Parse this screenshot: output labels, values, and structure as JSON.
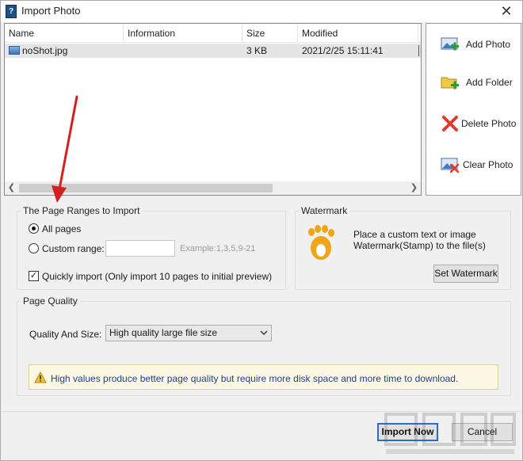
{
  "window": {
    "title": "Import Photo",
    "app_icon_glyph": "?"
  },
  "file_list": {
    "columns": [
      "Name",
      "Information",
      "Size",
      "Modified",
      ""
    ],
    "rows": [
      {
        "name": "noShot.jpg",
        "information": "",
        "size": "3 KB",
        "modified": "2021/2/25 15:11:41"
      }
    ]
  },
  "side_buttons": {
    "add_photo": "Add Photo",
    "add_folder": "Add Folder",
    "delete_photo": "Delete Photo",
    "clear_photo": "Clear Photo"
  },
  "page_ranges": {
    "legend": "The Page Ranges to Import",
    "all_pages": "All pages",
    "custom_range": "Custom range:",
    "custom_value": "",
    "example": "Example:1,3,5,9-21",
    "quick_import": "Quickly import (Only import 10 pages to  initial  preview)",
    "selected": "all_pages",
    "quick_import_checked": true
  },
  "watermark": {
    "legend": "Watermark",
    "desc_line1": "Place a custom text or image",
    "desc_line2": "Watermark(Stamp) to the file(s)",
    "button": "Set Watermark"
  },
  "page_quality": {
    "legend": "Page Quality",
    "label": "Quality And Size:",
    "selected": "High quality large file size",
    "warning": "High values produce better page quality but require more disk space and more time to download."
  },
  "footer": {
    "import_now": "Import Now",
    "cancel": "Cancel"
  },
  "colors": {
    "accent": "#2a6cc7",
    "warning_bg": "#fdf8e4",
    "warning_text": "#1e3f8f",
    "arrow": "#d42020"
  },
  "icons": {
    "add_photo": "add-photo-icon",
    "add_folder": "add-folder-icon",
    "delete_photo": "delete-icon",
    "clear_photo": "clear-photo-icon",
    "watermark": "watermark-logo-icon",
    "warning": "warning-triangle-icon"
  }
}
